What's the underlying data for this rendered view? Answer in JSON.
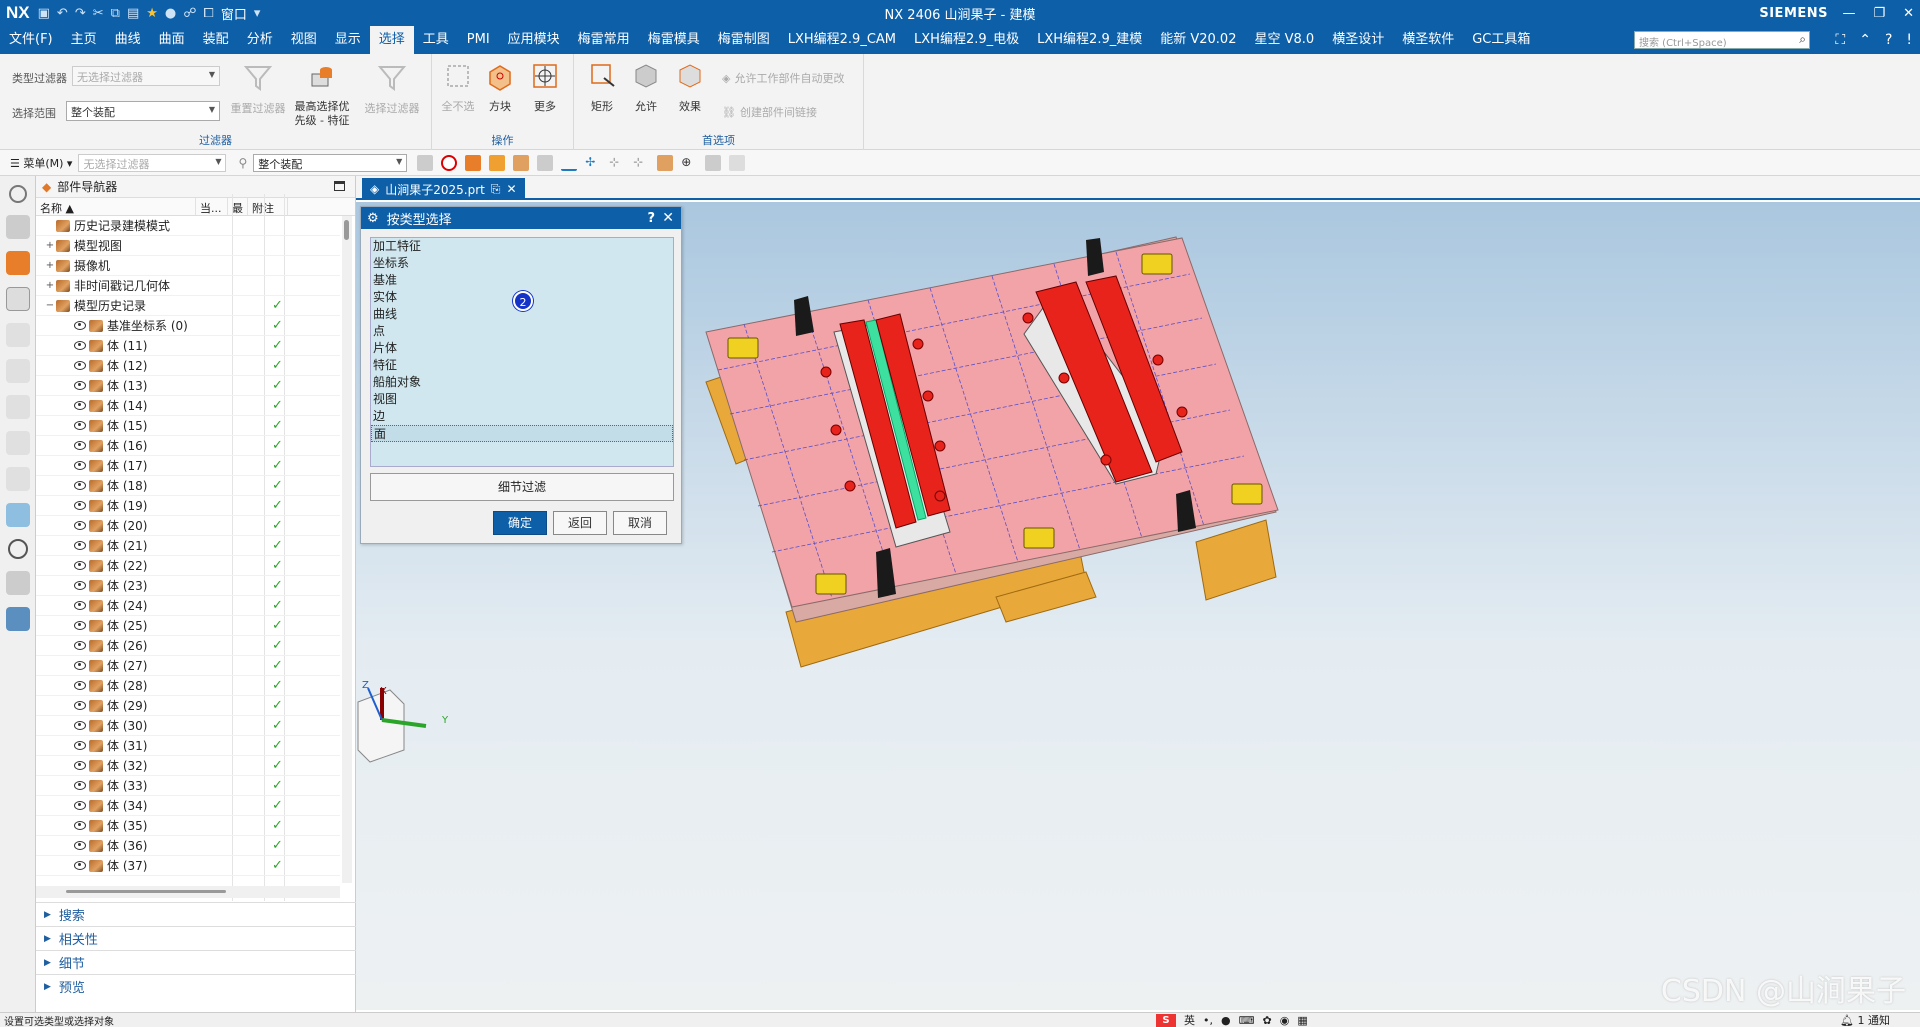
{
  "titlebar": {
    "logo": "NX",
    "title": "NX 2406 山涧果子 - 建模",
    "brand": "SIEMENS",
    "window_menu": "窗口"
  },
  "menubar": {
    "tabs": [
      "文件(F)",
      "主页",
      "曲线",
      "曲面",
      "装配",
      "分析",
      "视图",
      "显示",
      "选择",
      "工具",
      "PMI",
      "应用模块",
      "梅雷常用",
      "梅雷模具",
      "梅雷制图",
      "LXH编程2.9_CAM",
      "LXH编程2.9_电极",
      "LXH编程2.9_建模",
      "能新 V20.02",
      "星空 V8.0",
      "横圣设计",
      "横圣软件",
      "GC工具箱"
    ],
    "active_tab": "选择",
    "search_placeholder": "搜索 (Ctrl+Space)"
  },
  "ribbon": {
    "filter_group": {
      "type_filter_label": "类型过滤器",
      "type_filter_value": "无选择过滤器",
      "select_scope_label": "选择范围",
      "select_scope_value": "整个装配",
      "reset_filter": "重置过滤器",
      "highest_priority": "最高选择优先级 - 特征",
      "select_filter": "选择过滤器",
      "title": "过滤器"
    },
    "operation_group": {
      "deselect_all": "全不选",
      "box": "方块",
      "more": "更多",
      "title": "操作"
    },
    "preferences_group": {
      "rectangle": "矩形",
      "allow": "允许",
      "effect": "效果",
      "allow_part_change": "允许工作部件自动更改",
      "create_link": "创建部件间链接",
      "title": "首选项"
    }
  },
  "subtoolbar": {
    "menu": "菜单(M)",
    "filter_value": "无选择过滤器",
    "scope_value": "整个装配"
  },
  "navigator": {
    "title": "部件导航器",
    "columns": [
      "名称",
      "当...",
      "最",
      "附注"
    ],
    "rows": [
      {
        "label": "历史记录建模模式",
        "indent": 0,
        "toggle": "",
        "check": false
      },
      {
        "label": "模型视图",
        "indent": 0,
        "toggle": "+",
        "check": false
      },
      {
        "label": "摄像机",
        "indent": 0,
        "toggle": "+",
        "check": false
      },
      {
        "label": "非时间戳记几何体",
        "indent": 0,
        "toggle": "+",
        "check": false
      },
      {
        "label": "模型历史记录",
        "indent": 0,
        "toggle": "−",
        "check": true
      },
      {
        "label": "基准坐标系 (0)",
        "indent": 1,
        "toggle": "",
        "check": true
      },
      {
        "label": "体 (11)",
        "indent": 1,
        "toggle": "",
        "check": true
      },
      {
        "label": "体 (12)",
        "indent": 1,
        "toggle": "",
        "check": true
      },
      {
        "label": "体 (13)",
        "indent": 1,
        "toggle": "",
        "check": true
      },
      {
        "label": "体 (14)",
        "indent": 1,
        "toggle": "",
        "check": true
      },
      {
        "label": "体 (15)",
        "indent": 1,
        "toggle": "",
        "check": true
      },
      {
        "label": "体 (16)",
        "indent": 1,
        "toggle": "",
        "check": true
      },
      {
        "label": "体 (17)",
        "indent": 1,
        "toggle": "",
        "check": true
      },
      {
        "label": "体 (18)",
        "indent": 1,
        "toggle": "",
        "check": true
      },
      {
        "label": "体 (19)",
        "indent": 1,
        "toggle": "",
        "check": true
      },
      {
        "label": "体 (20)",
        "indent": 1,
        "toggle": "",
        "check": true
      },
      {
        "label": "体 (21)",
        "indent": 1,
        "toggle": "",
        "check": true
      },
      {
        "label": "体 (22)",
        "indent": 1,
        "toggle": "",
        "check": true
      },
      {
        "label": "体 (23)",
        "indent": 1,
        "toggle": "",
        "check": true
      },
      {
        "label": "体 (24)",
        "indent": 1,
        "toggle": "",
        "check": true
      },
      {
        "label": "体 (25)",
        "indent": 1,
        "toggle": "",
        "check": true
      },
      {
        "label": "体 (26)",
        "indent": 1,
        "toggle": "",
        "check": true
      },
      {
        "label": "体 (27)",
        "indent": 1,
        "toggle": "",
        "check": true
      },
      {
        "label": "体 (28)",
        "indent": 1,
        "toggle": "",
        "check": true
      },
      {
        "label": "体 (29)",
        "indent": 1,
        "toggle": "",
        "check": true
      },
      {
        "label": "体 (30)",
        "indent": 1,
        "toggle": "",
        "check": true
      },
      {
        "label": "体 (31)",
        "indent": 1,
        "toggle": "",
        "check": true
      },
      {
        "label": "体 (32)",
        "indent": 1,
        "toggle": "",
        "check": true
      },
      {
        "label": "体 (33)",
        "indent": 1,
        "toggle": "",
        "check": true
      },
      {
        "label": "体 (34)",
        "indent": 1,
        "toggle": "",
        "check": true
      },
      {
        "label": "体 (35)",
        "indent": 1,
        "toggle": "",
        "check": true
      },
      {
        "label": "体 (36)",
        "indent": 1,
        "toggle": "",
        "check": true
      },
      {
        "label": "体 (37)",
        "indent": 1,
        "toggle": "",
        "check": true
      }
    ],
    "sections": [
      "搜索",
      "相关性",
      "细节",
      "预览"
    ]
  },
  "document_tab": {
    "label": "山涧果子2025.prt"
  },
  "dialog": {
    "title": "按类型选择",
    "items": [
      "加工特征",
      "坐标系",
      "基准",
      "实体",
      "曲线",
      "点",
      "片体",
      "特征",
      "船舶对象",
      "视图",
      "边",
      "面"
    ],
    "selected_item": "面",
    "marker": "2",
    "detail_filter": "细节过滤",
    "ok": "确定",
    "back": "返回",
    "cancel": "取消"
  },
  "viewport": {
    "watermark": "CSDN @山涧果子",
    "axis_x": "X",
    "axis_y": "Y",
    "axis_z": "Z"
  },
  "statusbar": {
    "message": "设置可选类型或选择对象",
    "ime_lang": "英",
    "notice": "1 通知"
  },
  "colors": {
    "nx_blue": "#0d5fa8",
    "plate_pink": "#f2a3a8",
    "block_red": "#e8231b",
    "wood_orange": "#e8a83a",
    "check_green": "#2aa52a"
  }
}
